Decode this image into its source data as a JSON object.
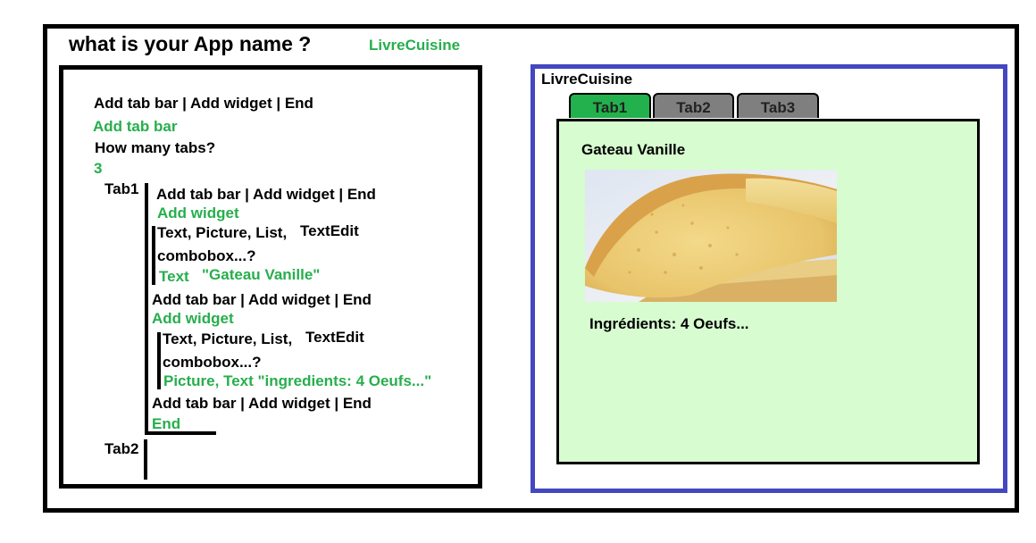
{
  "header": {
    "question": "what is your App name ?",
    "answer": "LivreCuisine"
  },
  "script": {
    "menu_line": "Add tab bar | Add widget | End",
    "answer_add_tab_bar": "Add tab bar",
    "how_many_tabs": "How many tabs?",
    "tabs_count": "3",
    "tab1_label": "Tab1",
    "tab2_label": "Tab2",
    "tab1": {
      "menu1": "Add tab bar | Add widget | End",
      "answer1": "Add widget",
      "widgets_q1_line1": "Text, Picture, List,",
      "widgets_q1_textedit": "TextEdit",
      "widgets_q1_line2": "combobox...?",
      "widget_answer1_type": "Text",
      "widget_answer1_value": "\"Gateau Vanille\"",
      "menu2": "Add tab bar | Add widget | End",
      "answer2": "Add widget",
      "widgets_q2_line1": "Text, Picture, List,",
      "widgets_q2_textedit": "TextEdit",
      "widgets_q2_line2": "combobox...?",
      "widget_answer2": "Picture, Text \"ingredients: 4 Oeufs...\"",
      "menu3": "Add tab bar | Add widget | End",
      "answer3": "End"
    }
  },
  "preview": {
    "app_title": "LivreCuisine",
    "tabs": [
      {
        "label": "Tab1",
        "active": true
      },
      {
        "label": "Tab2",
        "active": false
      },
      {
        "label": "Tab3",
        "active": false
      }
    ],
    "recipe_title": "Gateau Vanille",
    "ingredients": "Ingrédients: 4 Oeufs..."
  },
  "colors": {
    "green_text": "#27ae4d",
    "active_tab": "#22b14c",
    "inactive_tab": "#7f7f7f",
    "preview_border": "#4347c0",
    "content_background": "#d7fcd0"
  }
}
